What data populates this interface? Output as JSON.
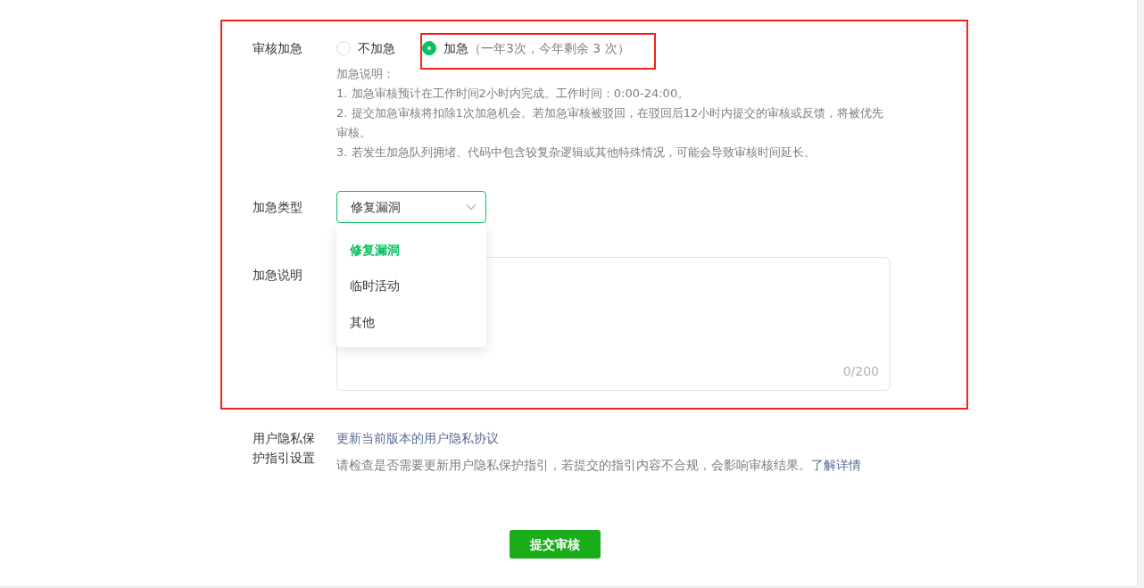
{
  "urgent_review": {
    "label": "审核加急",
    "options": [
      {
        "label": "不加急",
        "selected": false
      },
      {
        "label": "加急",
        "note": "（一年3次，今年剩余  3  次）",
        "selected": true
      }
    ],
    "notes": [
      "加急说明：",
      "1. 加急审核预计在工作时间2小时内完成。工作时间：0:00-24:00。",
      "2. 提交加急审核将扣除1次加急机会。若加急审核被驳回，在驳回后12小时内提交的审核或反馈，将被优先审核。",
      "3. 若发生加急队列拥堵、代码中包含较复杂逻辑或其他特殊情况，可能会导致审核时间延长。"
    ]
  },
  "urgent_type": {
    "label": "加急类型",
    "value": "修复漏洞",
    "expanded": true,
    "options": [
      {
        "label": "修复漏洞",
        "selected": true
      },
      {
        "label": "临时活动",
        "selected": false
      },
      {
        "label": "其他",
        "selected": false
      }
    ]
  },
  "urgent_description": {
    "label": "加急说明",
    "counter": "0/200"
  },
  "privacy": {
    "label": "用户隐私保护指引设置",
    "link": "更新当前版本的用户隐私协议",
    "note": "请检查是否需要更新用户隐私保护指引，若提交的指引内容不合规，会影响审核结果。",
    "note_link": "了解详情"
  },
  "submit_button": "提交审核"
}
